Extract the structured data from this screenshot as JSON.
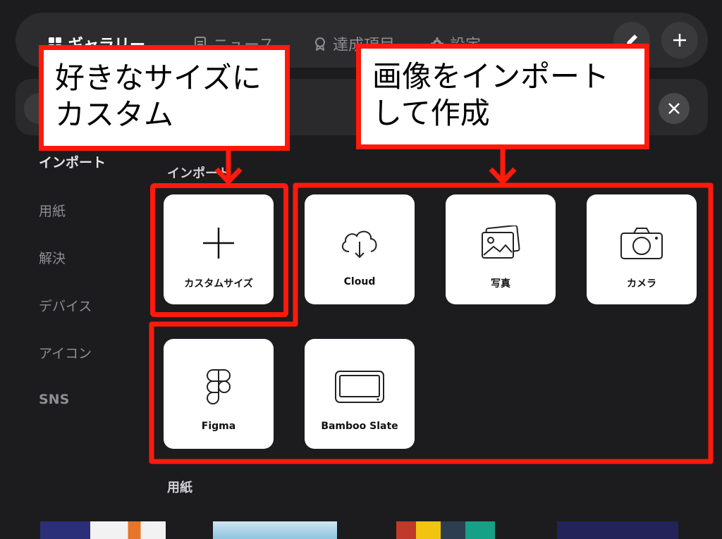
{
  "topbar": {
    "tabs": [
      {
        "label": "ギャラリー",
        "icon": "grid-icon",
        "active": true
      },
      {
        "label": "ニュース",
        "icon": "document-icon",
        "active": false
      },
      {
        "label": "達成項目",
        "icon": "badge-icon",
        "active": false
      },
      {
        "label": "設定",
        "icon": "gear-icon",
        "active": false
      }
    ]
  },
  "sidebar": {
    "items": [
      {
        "label": "インポート"
      },
      {
        "label": "用紙"
      },
      {
        "label": "解決"
      },
      {
        "label": "デバイス"
      },
      {
        "label": "アイコン"
      },
      {
        "label": "SNS"
      }
    ]
  },
  "sections": {
    "import_label": "インポート",
    "paper_label": "用紙"
  },
  "cards": [
    {
      "label": "カスタムサイズ",
      "icon": "plus-icon"
    },
    {
      "label": "Cloud",
      "icon": "cloud-download-icon"
    },
    {
      "label": "写真",
      "icon": "photos-icon"
    },
    {
      "label": "カメラ",
      "icon": "camera-icon"
    },
    {
      "label": "Figma",
      "icon": "figma-icon"
    },
    {
      "label": "Bamboo Slate",
      "icon": "tablet-icon"
    }
  ],
  "callouts": {
    "left_line1": "好きなサイズに",
    "left_line2": "カスタム",
    "right_line1": "画像をインポート",
    "right_line2": "して作成"
  },
  "colors": {
    "highlight": "#ff1a0c",
    "background": "#1c1c1e",
    "card": "#ffffff"
  }
}
